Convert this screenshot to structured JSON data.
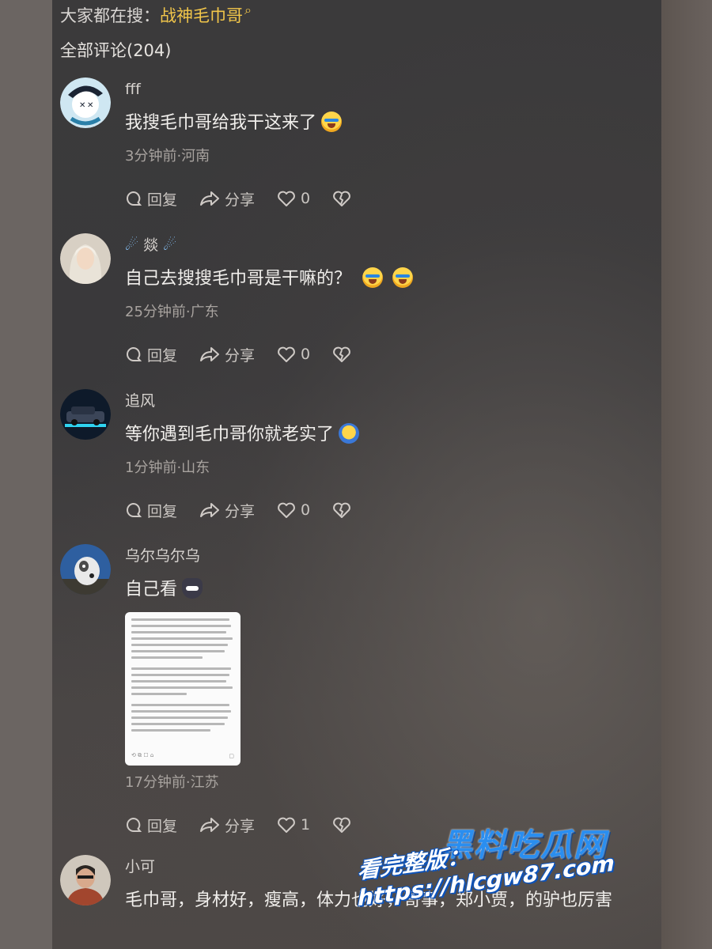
{
  "header": {
    "search_prefix": "大家都在搜：",
    "search_term": "战神毛巾哥",
    "comments_title": "全部评论(204)"
  },
  "actions": {
    "reply": "回复",
    "share": "分享"
  },
  "comments": [
    {
      "username": "fff",
      "text": "我搜毛巾哥给我干这来了",
      "meta": "3分钟前·河南",
      "likes": "0"
    },
    {
      "username": "燚",
      "text": "自己去搜搜毛巾哥是干嘛的？",
      "meta": "25分钟前·广东",
      "likes": "0"
    },
    {
      "username": "追风",
      "text": "等你遇到毛巾哥你就老实了",
      "meta": "1分钟前·山东",
      "likes": "0"
    },
    {
      "username": "乌尔乌尔乌",
      "text": "自己看",
      "meta": "17分钟前·江苏",
      "likes": "1"
    },
    {
      "username": "小可",
      "text": "毛巾哥，身材好，瘦高，体力也好，哥事，郑小贾，的驴也厉害"
    }
  ],
  "watermark": {
    "title": "黑料吃瓜网",
    "url": "看完整版：https://hlcgw87.com"
  }
}
